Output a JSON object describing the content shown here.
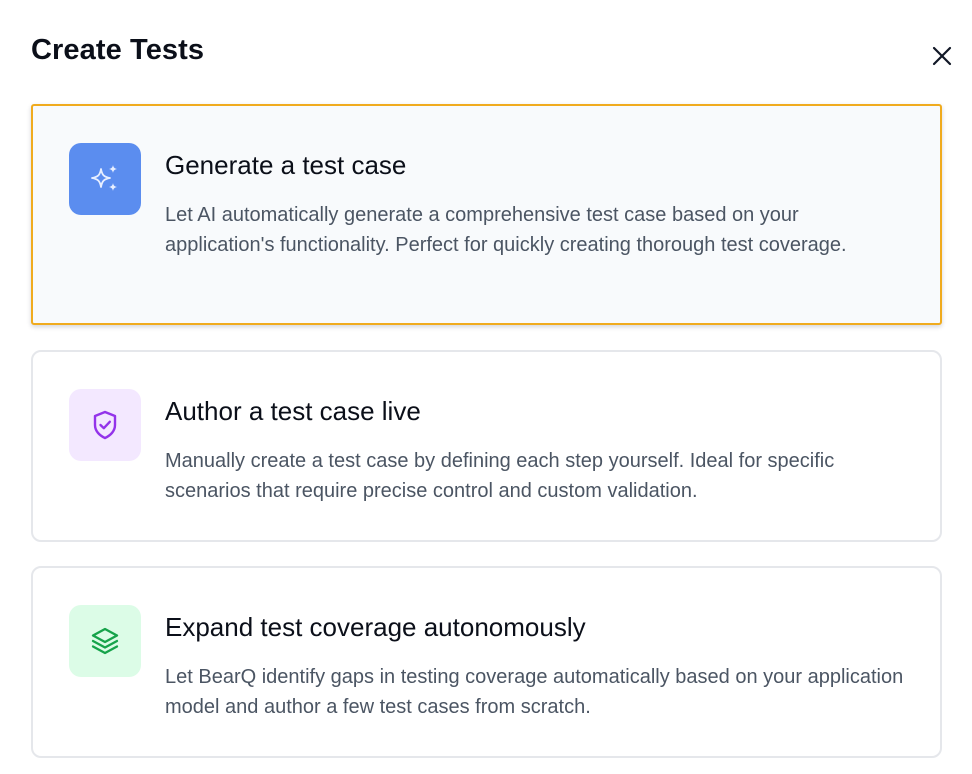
{
  "dialog": {
    "title": "Create Tests",
    "close_label": "Close"
  },
  "options": [
    {
      "title": "Generate a test case",
      "description": "Let AI automatically generate a comprehensive test case based on your application's functionality. Perfect for quickly creating thorough test coverage.",
      "icon": "sparkles-icon",
      "icon_bg": "#5b8def",
      "icon_color": "#e8efff",
      "selected": true
    },
    {
      "title": "Author a test case live",
      "description": "Manually create a test case by defining each step yourself. Ideal for specific scenarios that require precise control and custom validation.",
      "icon": "shield-check-icon",
      "icon_bg": "#f3e8ff",
      "icon_color": "#9333ea",
      "selected": false
    },
    {
      "title": "Expand test coverage autonomously",
      "description": "Let BearQ identify gaps in testing coverage automatically based on your application model and author a few test cases from scratch.",
      "icon": "layers-icon",
      "icon_bg": "#dcfce7",
      "icon_color": "#16a34a",
      "selected": false
    }
  ],
  "colors": {
    "selected_border": "#f0ab1e",
    "card_border": "#e5e7eb",
    "title_text": "#0b0f19",
    "body_text": "#4b5563"
  }
}
